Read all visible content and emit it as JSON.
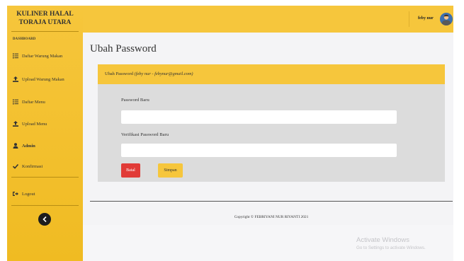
{
  "brand": {
    "line1": "KULINER HALAL",
    "line2": "TORAJA UTARA"
  },
  "sidebar": {
    "section_label": "DASHBOARD",
    "items": [
      {
        "label": "Daftar Warung Makan",
        "icon": "list-icon"
      },
      {
        "label": "Upload Warung Makan",
        "icon": "upload-icon"
      },
      {
        "label": "Daftar Menu",
        "icon": "list-icon"
      },
      {
        "label": "Upload Menu",
        "icon": "upload-icon"
      },
      {
        "label": "Admin",
        "icon": "user-icon"
      },
      {
        "label": "Konfirmasi",
        "icon": "check-icon"
      }
    ],
    "logout_label": "Logout"
  },
  "header": {
    "user_name": "feby nur"
  },
  "main": {
    "page_title": "Ubah Password",
    "card_title": "Ubah Password",
    "card_subtitle": "(feby nur - febynur@gmail.com)",
    "fields": [
      {
        "label": "Password Baru",
        "value": ""
      },
      {
        "label": "Verifikasi Password Baru",
        "value": ""
      }
    ],
    "buttons": {
      "cancel": "Batal",
      "save": "Simpan"
    }
  },
  "footer": {
    "copyright": "Copyright © FEBRIYANI NUR RIYANTI 2021"
  },
  "watermark": {
    "title": "Activate Windows",
    "subtitle": "Go to Settings to activate Windows."
  },
  "colors": {
    "accent": "#f6c63c",
    "danger": "#e13b37",
    "card_bg": "#dcdcdc"
  }
}
